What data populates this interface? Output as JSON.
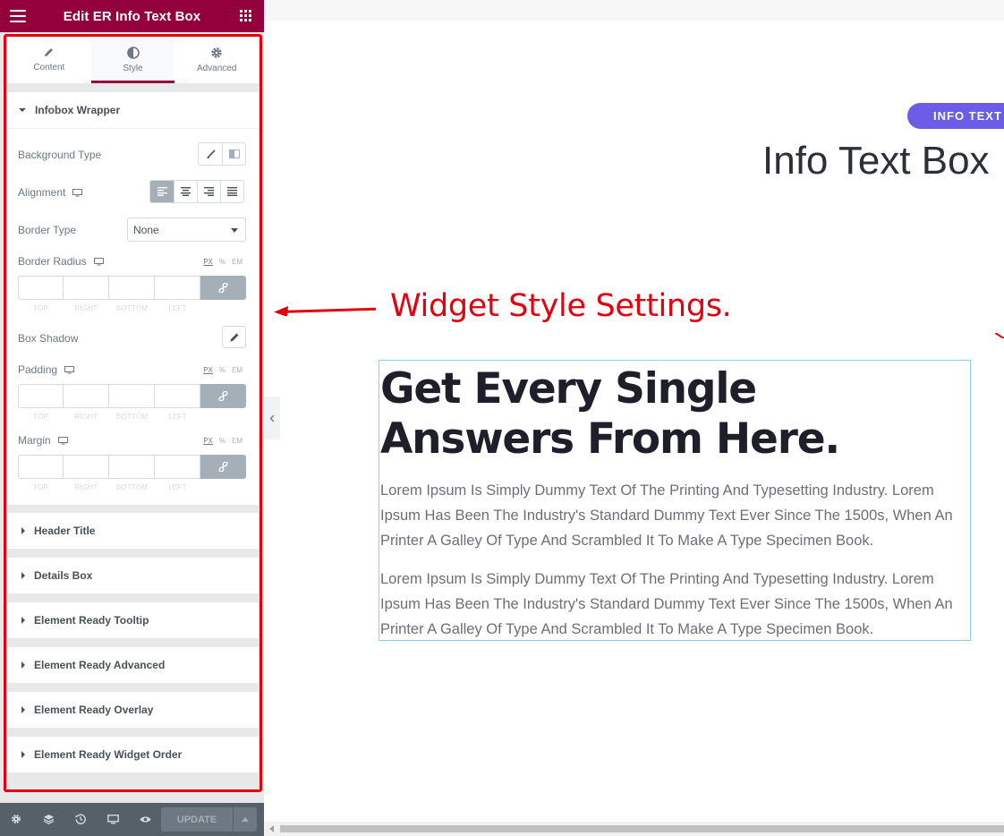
{
  "panel": {
    "title": "Edit ER Info Text Box",
    "tabs": [
      {
        "label": "Content",
        "icon": "pencil-icon"
      },
      {
        "label": "Style",
        "icon": "contrast-icon"
      },
      {
        "label": "Advanced",
        "icon": "gear-icon"
      }
    ],
    "active_tab": "Style",
    "accent_color": "#93003c",
    "infobox_wrapper": {
      "title": "Infobox Wrapper",
      "background_type_label": "Background Type",
      "alignment_label": "Alignment",
      "border_type_label": "Border Type",
      "border_type_value": "None",
      "border_radius_label": "Border Radius",
      "box_shadow_label": "Box Shadow",
      "padding_label": "Padding",
      "margin_label": "Margin",
      "units": [
        "PX",
        "%",
        "EM"
      ],
      "dimension_labels": [
        "TOP",
        "RIGHT",
        "BOTTOM",
        "LEFT"
      ]
    },
    "sections": [
      "Header Title",
      "Details Box",
      "Element Ready Tooltip",
      "Element Ready Advanced",
      "Element Ready Overlay",
      "Element Ready Widget Order"
    ],
    "update_label": "UPDATE"
  },
  "preview": {
    "badge": "INFO TEXT",
    "title": "Info Text Box",
    "callout": "Widget Style Settings.",
    "heading": "Get Every Single Answers From Here.",
    "paragraph1": "Lorem Ipsum Is Simply Dummy Text Of The Printing And Typesetting Industry. Lorem Ipsum Has Been The Industry's Standard Dummy Text Ever Since The 1500s, When An Printer A Galley Of Type And Scrambled It To Make A Type Specimen Book.",
    "paragraph2": "Lorem Ipsum Is Simply Dummy Text Of The Printing And Typesetting Industry. Lorem Ipsum Has Been The Industry's Standard Dummy Text Ever Since The 1500s, When An Printer A Galley Of Type And Scrambled It To Make A Type Specimen Book.",
    "badge_color": "#6c5ce7",
    "callout_color": "#e3000f"
  }
}
